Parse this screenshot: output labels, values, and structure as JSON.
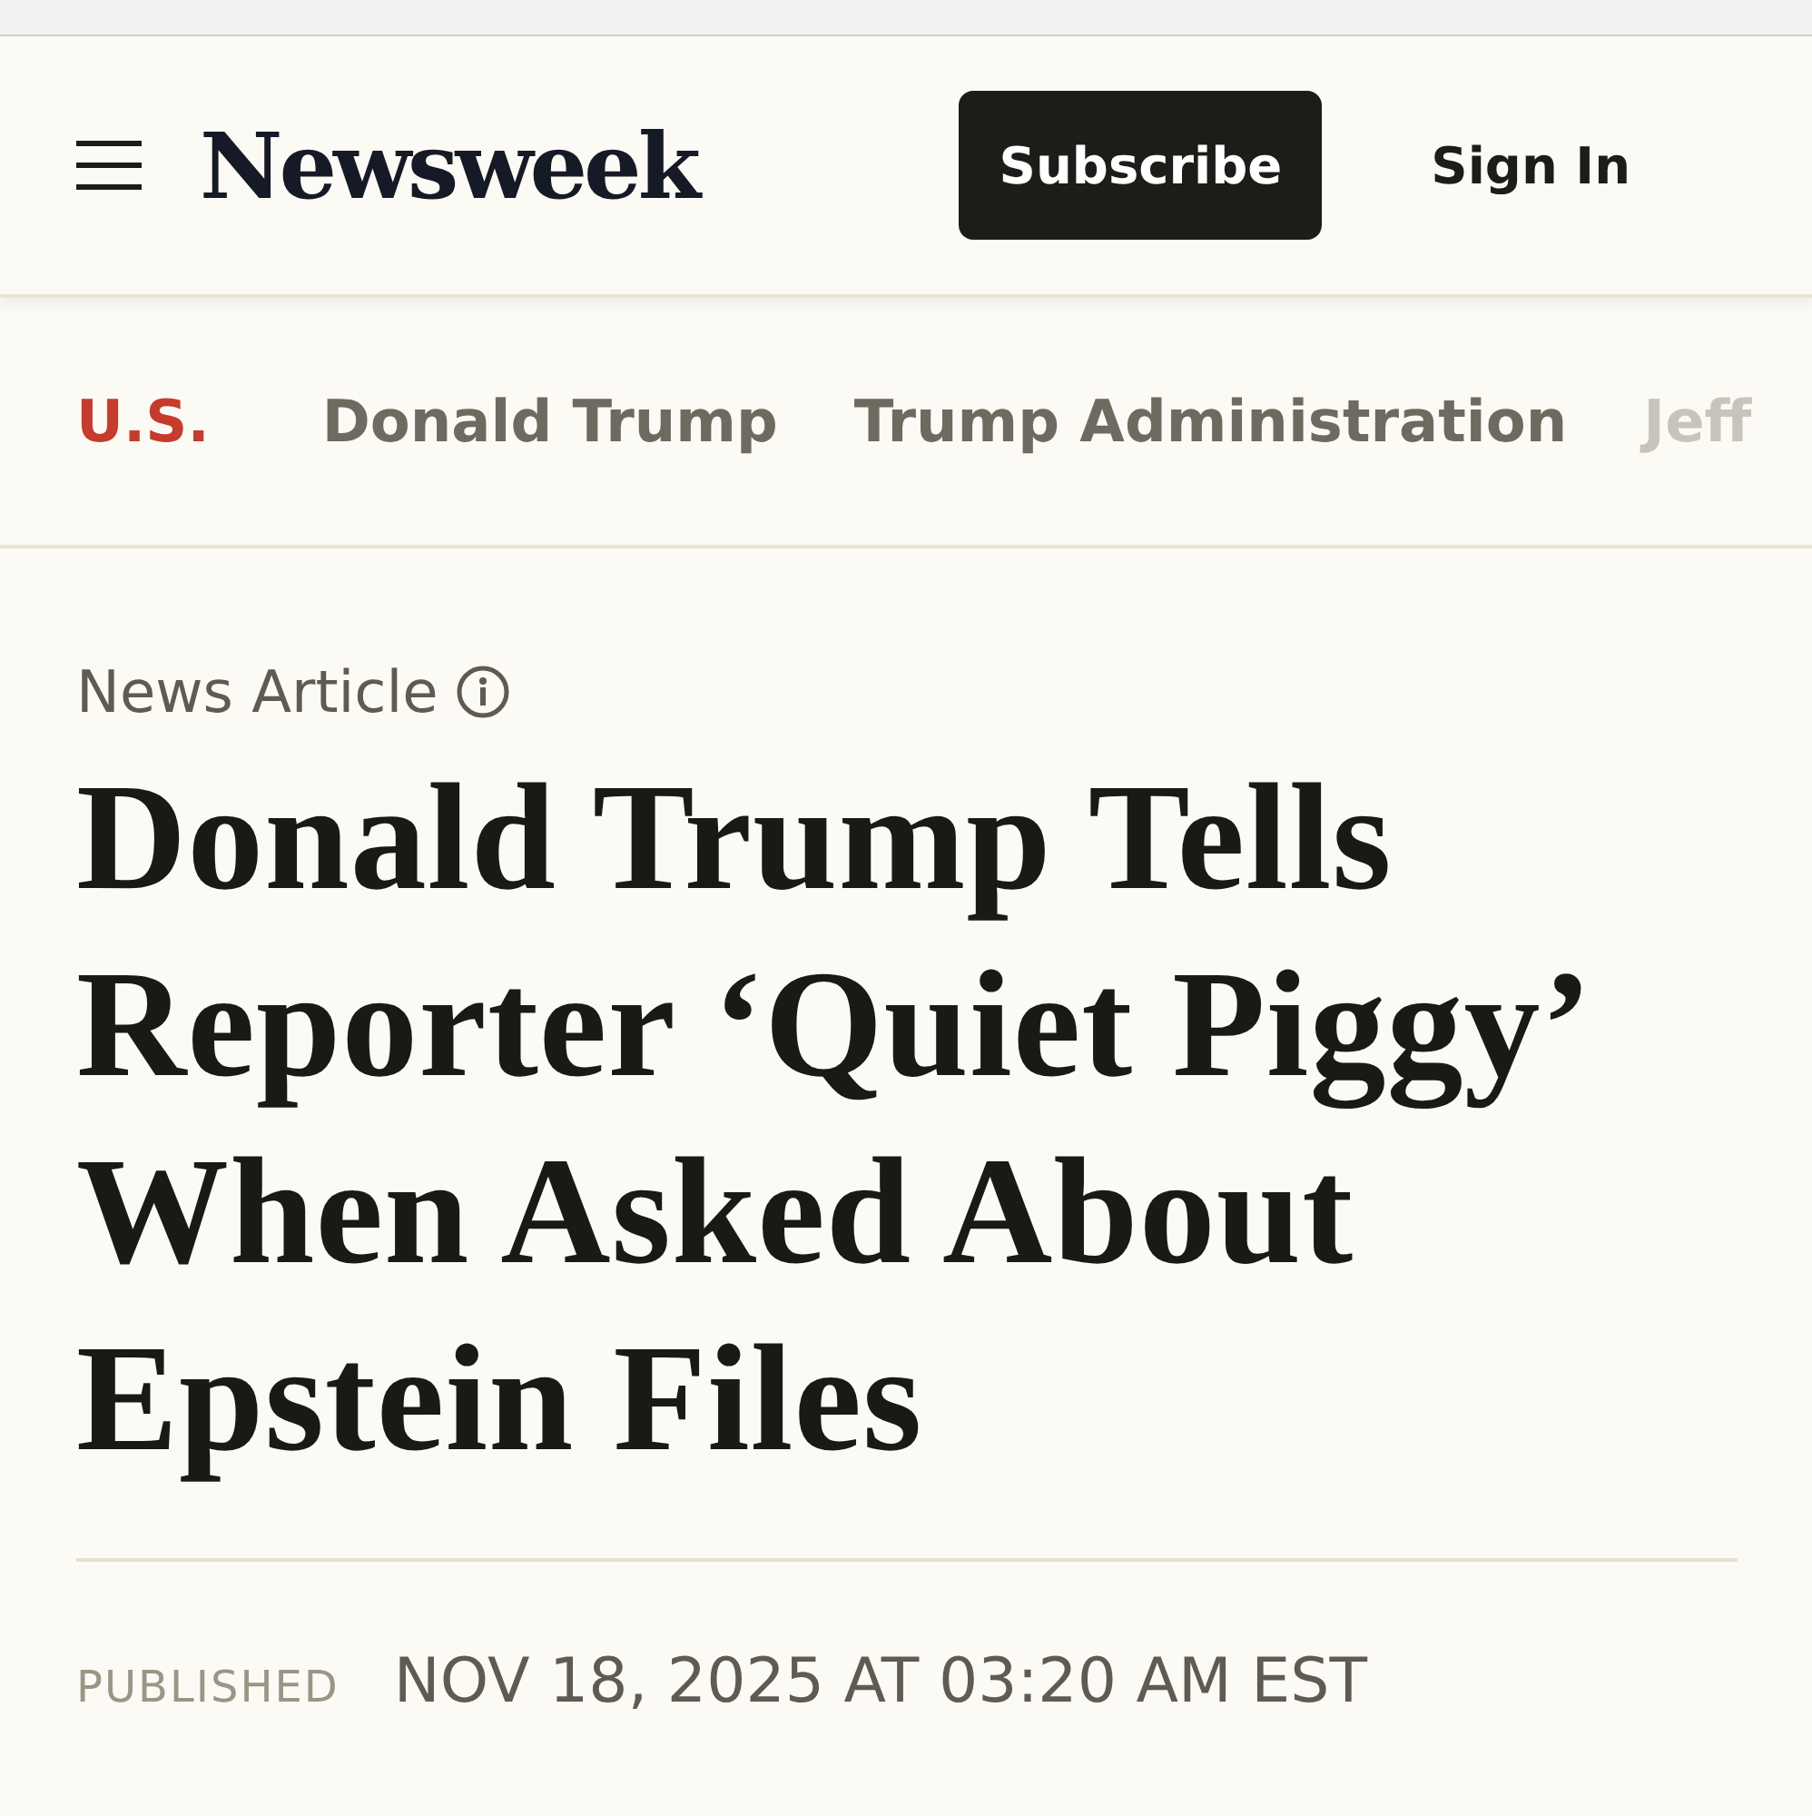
{
  "header": {
    "logo": "Newsweek",
    "subscribe": "Subscribe",
    "sign_in": "Sign In"
  },
  "nav": [
    {
      "label": "U.S.",
      "selected": true
    },
    {
      "label": "Donald Trump",
      "selected": false
    },
    {
      "label": "Trump Administration",
      "selected": false
    },
    {
      "label": "Jeff",
      "selected": false
    }
  ],
  "article": {
    "type": "News Article",
    "headline": "Donald Trump Tells Reporter ‘Quiet Piggy’ When Asked About Epstein Files",
    "published_label": "PUBLISHED",
    "published": "NOV 18, 2025 AT 03:20 AM EST"
  }
}
